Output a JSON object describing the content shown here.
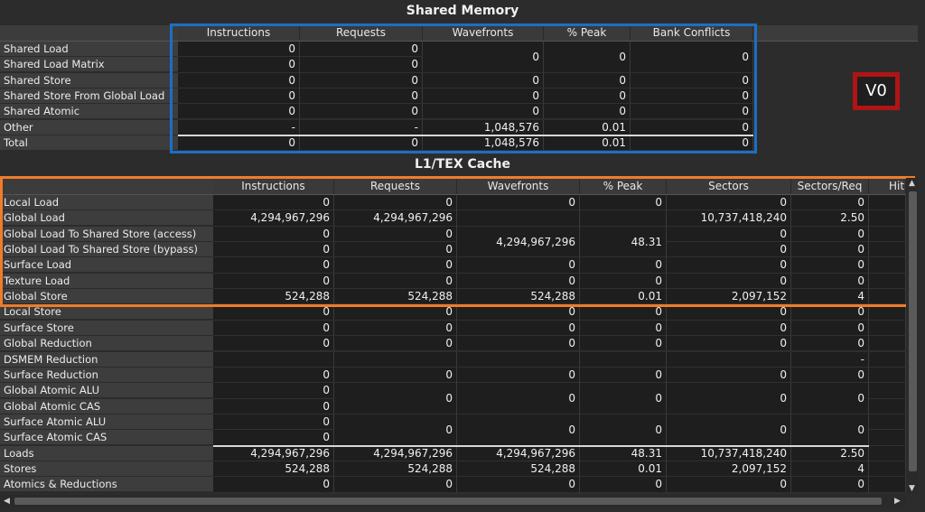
{
  "shared_memory": {
    "title": "Shared Memory",
    "columns": [
      "Instructions",
      "Requests",
      "Wavefronts",
      "% Peak",
      "Bank Conflicts"
    ],
    "rows": [
      {
        "label": "Shared Load",
        "instructions": "0",
        "requests": "0"
      },
      {
        "label": "Shared Load Matrix",
        "instructions": "0",
        "requests": "0"
      },
      {
        "label": "Shared Store",
        "instructions": "0",
        "requests": "0",
        "wavefronts": "0",
        "peak": "0",
        "bank_conflicts": "0"
      },
      {
        "label": "Shared Store From Global Load",
        "instructions": "0",
        "requests": "0",
        "wavefronts": "0",
        "peak": "0",
        "bank_conflicts": "0"
      },
      {
        "label": "Shared Atomic",
        "instructions": "0",
        "requests": "0",
        "wavefronts": "0",
        "peak": "0",
        "bank_conflicts": "0"
      },
      {
        "label": "Other",
        "instructions": "-",
        "requests": "-",
        "wavefronts": "1,048,576",
        "peak": "0.01",
        "bank_conflicts": "0"
      },
      {
        "label": "Total",
        "instructions": "0",
        "requests": "0",
        "wavefronts": "1,048,576",
        "peak": "0.01",
        "bank_conflicts": "0"
      }
    ],
    "merged_load": {
      "wavefronts": "0",
      "peak": "0",
      "bank_conflicts": "0"
    }
  },
  "badge": {
    "label": "V0",
    "color": "#b01414"
  },
  "l1tex": {
    "title": "L1/TEX Cache",
    "columns": [
      "Instructions",
      "Requests",
      "Wavefronts",
      "% Peak",
      "Sectors",
      "Sectors/Req",
      "Hit"
    ],
    "rows": [
      {
        "label": "Local Load",
        "instructions": "0",
        "requests": "0",
        "wavefronts": "0",
        "peak": "0",
        "sectors": "0",
        "sectors_req": "0"
      },
      {
        "label": "Global Load",
        "instructions": "4,294,967,296",
        "requests": "4,294,967,296",
        "wavefronts": "",
        "peak": "",
        "sectors": "10,737,418,240",
        "sectors_req": "2.50"
      },
      {
        "label": "Global Load To Shared Store (access)",
        "instructions": "0",
        "requests": "0",
        "sectors": "0",
        "sectors_req": "0"
      },
      {
        "label": "Global Load To Shared Store (bypass)",
        "instructions": "0",
        "requests": "0",
        "sectors": "0",
        "sectors_req": "0"
      },
      {
        "label": "Surface Load",
        "instructions": "0",
        "requests": "0",
        "wavefronts": "0",
        "peak": "0",
        "sectors": "0",
        "sectors_req": "0"
      },
      {
        "label": "Texture Load",
        "instructions": "0",
        "requests": "0",
        "wavefronts": "0",
        "peak": "0",
        "sectors": "0",
        "sectors_req": "0"
      },
      {
        "label": "Global Store",
        "instructions": "524,288",
        "requests": "524,288",
        "wavefronts": "524,288",
        "peak": "0.01",
        "sectors": "2,097,152",
        "sectors_req": "4"
      },
      {
        "label": "Local Store",
        "instructions": "0",
        "requests": "0",
        "wavefronts": "0",
        "peak": "0",
        "sectors": "0",
        "sectors_req": "0"
      },
      {
        "label": "Surface Store",
        "instructions": "0",
        "requests": "0",
        "wavefronts": "0",
        "peak": "0",
        "sectors": "0",
        "sectors_req": "0"
      },
      {
        "label": "Global Reduction",
        "instructions": "0",
        "requests": "0",
        "wavefronts": "0",
        "peak": "0",
        "sectors": "0",
        "sectors_req": "0"
      },
      {
        "label": "DSMEM Reduction",
        "instructions": "",
        "requests": "",
        "wavefronts": "",
        "peak": "",
        "sectors": "",
        "sectors_req": "-"
      },
      {
        "label": "Surface Reduction",
        "instructions": "0",
        "requests": "0",
        "wavefronts": "0",
        "peak": "0",
        "sectors": "0",
        "sectors_req": "0"
      },
      {
        "label": "Global Atomic ALU",
        "instructions": "0"
      },
      {
        "label": "Global Atomic CAS",
        "instructions": "0"
      },
      {
        "label": "Surface Atomic ALU",
        "instructions": "0"
      },
      {
        "label": "Surface Atomic CAS",
        "instructions": "0"
      },
      {
        "label": "Loads",
        "instructions": "4,294,967,296",
        "requests": "4,294,967,296",
        "wavefronts": "4,294,967,296",
        "peak": "48.31",
        "sectors": "10,737,418,240",
        "sectors_req": "2.50"
      },
      {
        "label": "Stores",
        "instructions": "524,288",
        "requests": "524,288",
        "wavefronts": "524,288",
        "peak": "0.01",
        "sectors": "2,097,152",
        "sectors_req": "4"
      },
      {
        "label": "Atomics & Reductions",
        "instructions": "0",
        "requests": "0",
        "wavefronts": "0",
        "peak": "0",
        "sectors": "0",
        "sectors_req": "0"
      }
    ],
    "merged_gl2ss": {
      "wavefronts": "4,294,967,296",
      "peak": "48.31"
    },
    "merged_global_atomic": {
      "requests": "0",
      "wavefronts": "0",
      "peak": "0",
      "sectors": "0",
      "sectors_req": "0"
    },
    "merged_surface_atomic": {
      "requests": "0",
      "wavefronts": "0",
      "peak": "0",
      "sectors": "0",
      "sectors_req": "0"
    }
  },
  "colors": {
    "blue_highlight": "#1c6fc4",
    "orange_highlight": "#ee7d2a"
  }
}
